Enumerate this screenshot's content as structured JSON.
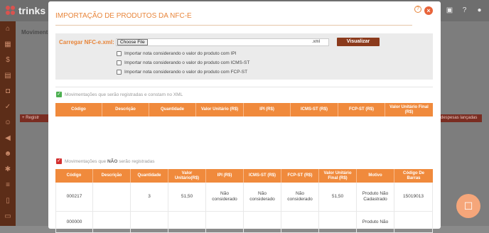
{
  "app": {
    "logo_text": "trinks"
  },
  "background": {
    "title": "Moviment",
    "left_button": "+ Registr",
    "right_button": "despesas lançadas"
  },
  "modal": {
    "title": "IMPORTAÇÃO DE PRODUTOS DA NFC-E",
    "help_icon": "?",
    "close_icon": "×",
    "load": {
      "label": "Carregar NFC-e.xml:",
      "file_button": "Choose File",
      "file_ext": ".xml",
      "visualizar": "Visualizar",
      "options": [
        "Importar nota considerando o valor do produto com IPI",
        "Importar nota considerando o valor do produto com ICMS-ST",
        "Importar nota considerando o valor do produto com FCP-ST"
      ]
    },
    "registered": {
      "label_prefix": "Movimentações que serão registradas e constam no XML",
      "columns": [
        "Código",
        "Descrição",
        "Quantidade",
        "Valor Unitário (R$)",
        "IPI (R$)",
        "ICMS-ST (R$)",
        "FCP-ST (R$)",
        "Valor Unitário Final (R$)"
      ]
    },
    "not_registered": {
      "label_prefix": "Movimentações que",
      "label_bold": "NÃO",
      "label_suffix": "serão registradas",
      "columns": [
        "Código",
        "Descrição",
        "Quantidade",
        "Valor Unitário(R$)",
        "IPI (R$)",
        "ICMS-ST (R$)",
        "FCP-ST (R$)",
        "Valor Unitário Final (R$)",
        "Motivo",
        "Código De Barras"
      ],
      "rows": [
        [
          "000217",
          "",
          "3",
          "51,50",
          "Não considerado",
          "Não considerado",
          "Não considerado",
          "51,50",
          "Produto Não Cadastrado",
          "15019013"
        ],
        [
          "000000",
          "",
          "",
          "",
          "",
          "",
          "",
          "",
          "Produto Não",
          ""
        ]
      ]
    }
  },
  "colors": {
    "accent": "#f08a3c",
    "brand": "#8b3a1c",
    "check_green": "#4caf50",
    "check_red": "#d32f2f"
  }
}
